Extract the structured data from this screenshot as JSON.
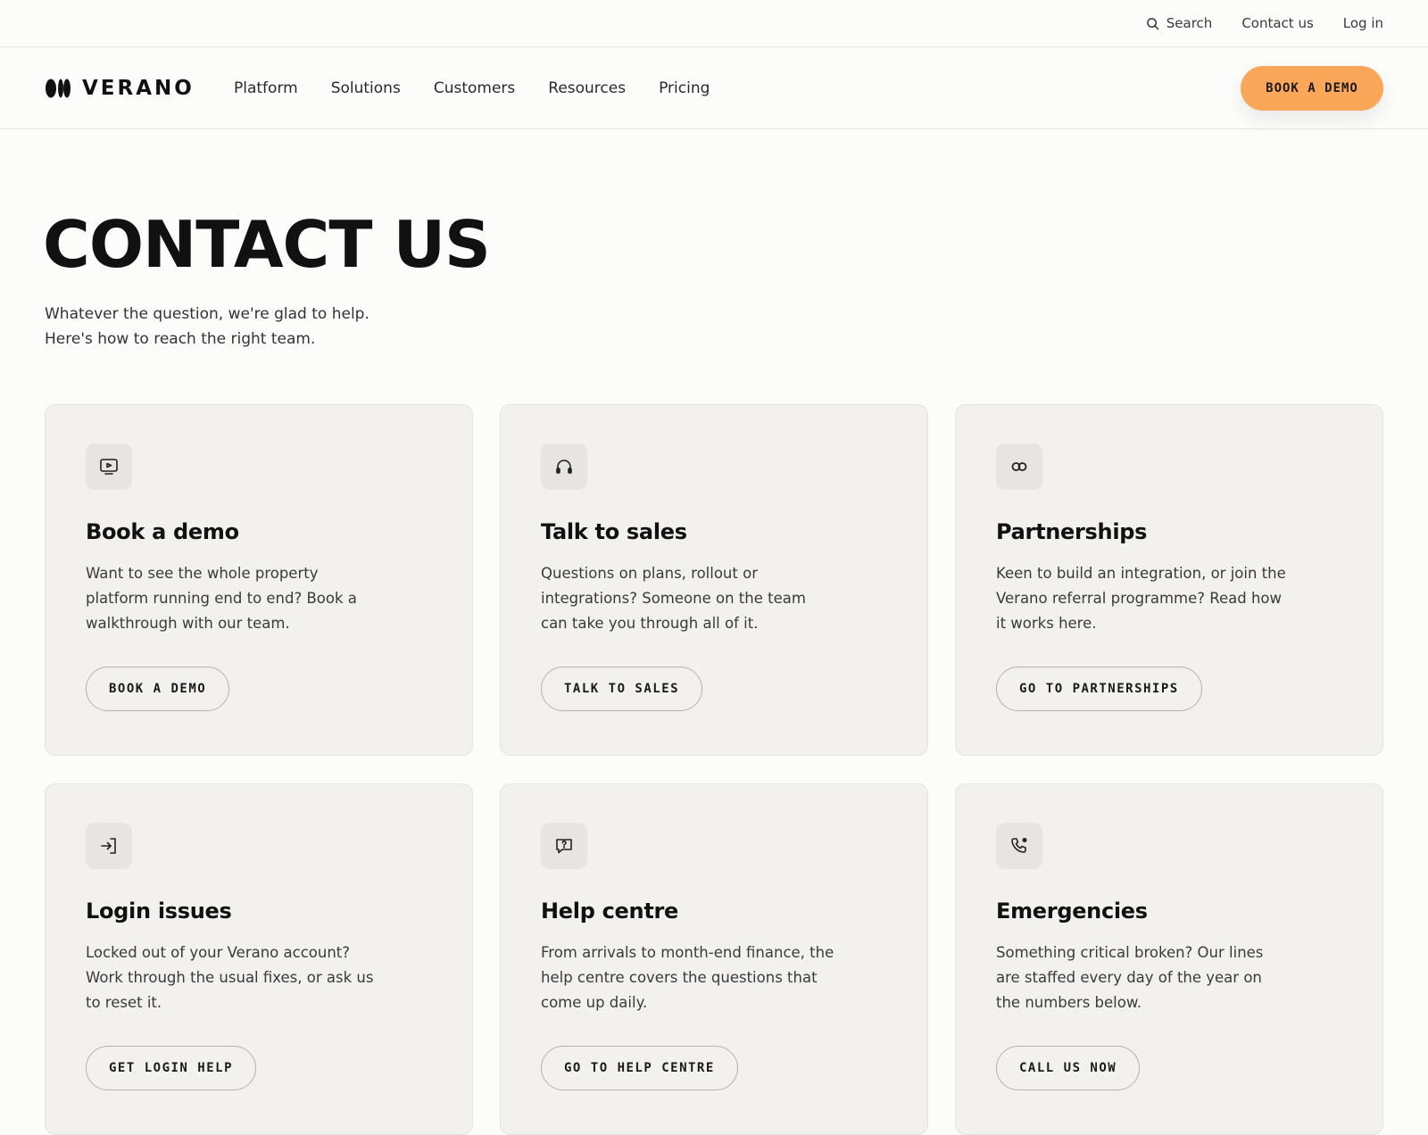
{
  "utility_bar": {
    "search_label": "Search",
    "contact_label": "Contact us",
    "login_label": "Log in"
  },
  "nav": {
    "logo_text": "VERANO",
    "links": [
      "Platform",
      "Solutions",
      "Customers",
      "Resources",
      "Pricing"
    ],
    "cta_label": "BOOK A DEMO"
  },
  "hero": {
    "title": "CONTACT US",
    "subtitle_lines": [
      "Whatever the question, we're glad to help.",
      "Here's how to reach the right team."
    ]
  },
  "cards": [
    {
      "icon": "monitor-play-icon",
      "title": "Book a demo",
      "description": "Want to see the whole property platform running end to end? Book a walkthrough with our team.",
      "button": "BOOK A DEMO"
    },
    {
      "icon": "headphones-icon",
      "title": "Talk to sales",
      "description": "Questions on plans, rollout or integrations? Someone on the team can take you through all of it.",
      "button": "TALK TO SALES"
    },
    {
      "icon": "linked-rings-icon",
      "title": "Partnerships",
      "description": "Keen to build an integration, or join the Verano referral programme? Read how it works here.",
      "button": "GO TO PARTNERSHIPS"
    },
    {
      "icon": "login-arrow-icon",
      "title": "Login issues",
      "description": "Locked out of your Verano account? Work through the usual fixes, or ask us to reset it.",
      "button": "GET LOGIN HELP"
    },
    {
      "icon": "help-chat-icon",
      "title": "Help centre",
      "description": "From arrivals to month-end finance, the help centre covers the questions that come up daily.",
      "button": "GO TO HELP CENTRE"
    },
    {
      "icon": "phone-alert-icon",
      "title": "Emergencies",
      "description": "Something critical broken? Our lines are staffed every day of the year on the numbers below.",
      "button": "CALL US NOW"
    }
  ],
  "colors": {
    "accent": "#fba759",
    "card_background": "#f2f1ee",
    "page_background": "#fcfcfb"
  }
}
